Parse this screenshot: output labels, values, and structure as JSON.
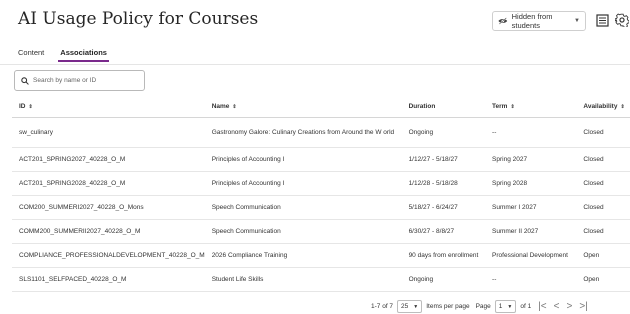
{
  "page": {
    "title": "AI Usage Policy for Courses"
  },
  "visibility": {
    "label": "Hidden from students",
    "icon": "eye-slash-icon"
  },
  "toolbar": {
    "report_icon": "report-icon",
    "settings_icon": "gear-icon"
  },
  "tabs": [
    {
      "label": "Content",
      "active": false
    },
    {
      "label": "Associations",
      "active": true
    }
  ],
  "search": {
    "placeholder": "Search by name or ID",
    "value": ""
  },
  "table": {
    "columns": [
      "ID",
      "Name",
      "Duration",
      "Term",
      "Availability"
    ],
    "rows": [
      {
        "id": "sw_culinary",
        "name": "Gastronomy Galore: Culinary Creations from Around the W orld",
        "duration": "Ongoing",
        "term": "--",
        "availability": "Closed"
      },
      {
        "id": "ACT201_SPRING2027_40228_O_M",
        "name": "Principles of Accounting I",
        "duration": "1/12/27 - 5/18/27",
        "term": "Spring 2027",
        "availability": "Closed"
      },
      {
        "id": "ACT201_SPRING2028_40228_O_M",
        "name": "Principles of Accounting I",
        "duration": "1/12/28 - 5/18/28",
        "term": "Spring 2028",
        "availability": "Closed"
      },
      {
        "id": "COM200_SUMMERI2027_40228_O_Mons",
        "name": "Speech Communication",
        "duration": "5/18/27 - 6/24/27",
        "term": "Summer I 2027",
        "availability": "Closed"
      },
      {
        "id": "COMM200_SUMMERII2027_40228_O_M",
        "name": "Speech Communication",
        "duration": "6/30/27 - 8/8/27",
        "term": "Summer II 2027",
        "availability": "Closed"
      },
      {
        "id": "COMPLIANCE_PROFESSIONALDEVELOPMENT_40228_O_M",
        "name": "2026 Compliance Training",
        "duration": "90 days from enrollment",
        "term": "Professional Development",
        "availability": "Open"
      },
      {
        "id": "SLS1101_SELFPACED_40228_O_M",
        "name": "Student Life Skills",
        "duration": "Ongoing",
        "term": "--",
        "availability": "Open"
      }
    ]
  },
  "pagination": {
    "range": "1-7 of 7",
    "per_page": "25",
    "per_page_label": "Items per page",
    "page_label": "Page",
    "page": "1",
    "of_label": "of 1"
  }
}
